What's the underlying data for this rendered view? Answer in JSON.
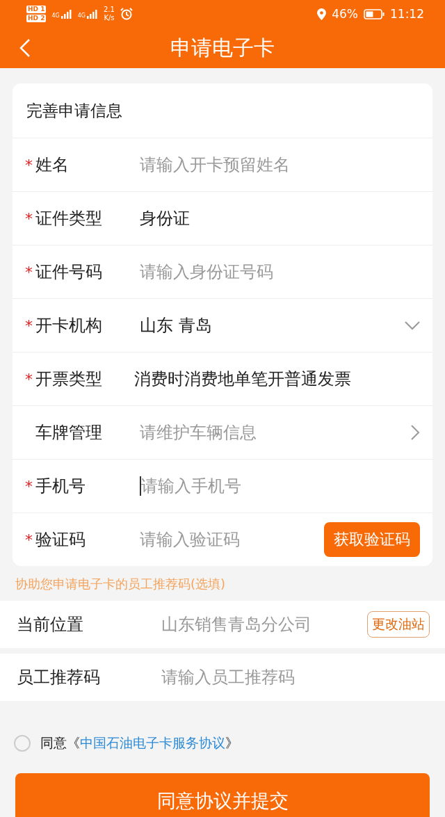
{
  "status_bar": {
    "sim1": "HD 1",
    "sim2": "HD 2",
    "net1": "4G",
    "net2": "4G",
    "speed": "2.1",
    "speed_unit": "K/s",
    "battery": "46%",
    "time": "11:12"
  },
  "header": {
    "title": "申请电子卡"
  },
  "form": {
    "title": "完善申请信息",
    "fields": [
      {
        "label": "姓名",
        "mark": "*",
        "kind": "input",
        "placeholder": "请输入开卡预留姓名",
        "focused": false
      },
      {
        "label": "证件类型",
        "mark": "*",
        "kind": "value",
        "value": "身份证"
      },
      {
        "label": "证件号码",
        "mark": "*",
        "kind": "input",
        "placeholder": "请输入身份证号码",
        "focused": false
      },
      {
        "label": "开卡机构",
        "mark": "*",
        "kind": "select",
        "value": "山东 青岛"
      },
      {
        "label": "开票类型",
        "mark": "*",
        "kind": "value",
        "value": "消费时消费地单笔开普通发票"
      },
      {
        "label": "车牌管理",
        "kind": "link",
        "placeholder": "请维护车辆信息"
      },
      {
        "label": "手机号",
        "mark": "*",
        "kind": "input",
        "placeholder": "请输入手机号",
        "focused": true
      },
      {
        "label": "验证码",
        "mark": "*",
        "kind": "code",
        "placeholder": "请输入验证码",
        "button": "获取验证码"
      }
    ]
  },
  "referral": {
    "hint": "协助您申请电子卡的员工推荐码(选填)",
    "location": {
      "label": "当前位置",
      "value": "山东销售青岛分公司",
      "button": "更改油站"
    },
    "code": {
      "label": "员工推荐码",
      "placeholder": "请输入员工推荐码"
    }
  },
  "agreement": {
    "checked": false,
    "prefix": "同意《",
    "link": "中国石油电子卡服务协议",
    "suffix": "》"
  },
  "submit": "同意协议并提交"
}
